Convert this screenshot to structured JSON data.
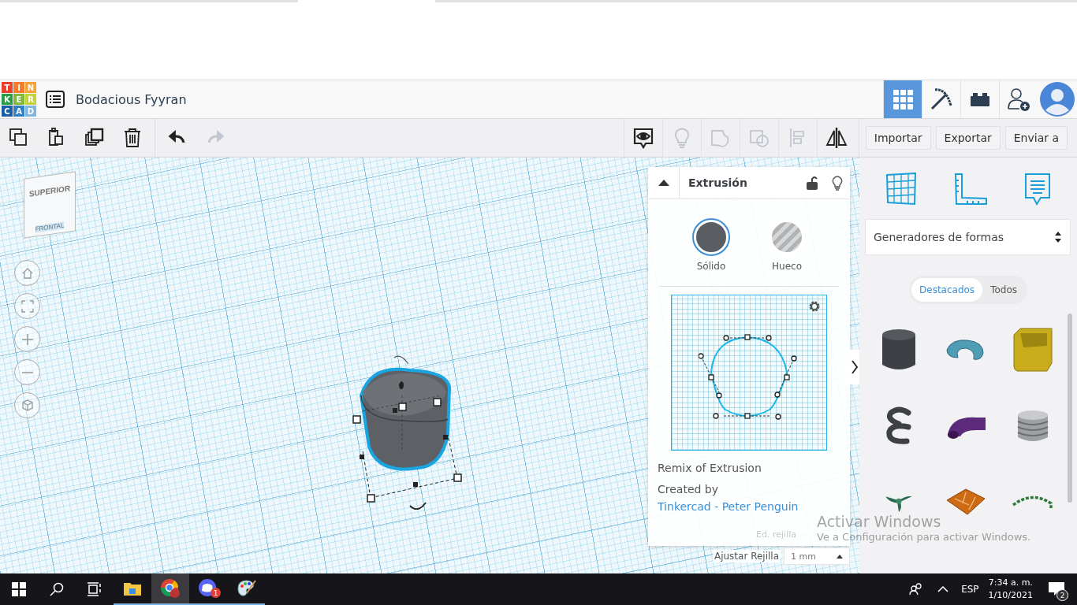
{
  "header": {
    "logo_letters": [
      "T",
      "I",
      "N",
      "K",
      "E",
      "R",
      "C",
      "A",
      "D"
    ],
    "title": "Bodacious Fyyran",
    "view_buttons": [
      {
        "kind": "grid",
        "selected": true
      },
      {
        "kind": "pickaxe",
        "selected": false
      },
      {
        "kind": "brick",
        "selected": false
      }
    ]
  },
  "toolbar": {
    "tools": [
      {
        "kind": "copy",
        "disabled": false
      },
      {
        "kind": "paste",
        "disabled": false
      },
      {
        "kind": "duplicate",
        "disabled": false
      },
      {
        "kind": "delete",
        "disabled": false
      },
      {
        "kind": "undo",
        "disabled": false
      },
      {
        "kind": "redo",
        "disabled": true
      }
    ],
    "right_tools": [
      {
        "kind": "eye",
        "disabled": false
      },
      {
        "kind": "bulb",
        "disabled": true
      },
      {
        "kind": "group",
        "disabled": true
      },
      {
        "kind": "ungroup",
        "disabled": true
      },
      {
        "kind": "align",
        "disabled": true
      },
      {
        "kind": "mirror",
        "disabled": false
      }
    ],
    "buttons": [
      "Importar",
      "Exportar",
      "Enviar a"
    ]
  },
  "view_cube": {
    "top": "SUPERIOR",
    "front": "FRONTAL"
  },
  "inspector": {
    "title": "Extrusión",
    "locked": false,
    "modes": [
      {
        "label": "Sólido",
        "kind": "solid",
        "selected": true
      },
      {
        "label": "Hueco",
        "kind": "hole",
        "selected": false
      }
    ],
    "remix": "Remix of Extrusion",
    "credit_prefix": "Created by",
    "credit_link": "Tinkercad - Peter Penguin"
  },
  "grid_settings": {
    "edit_label": "Ed. rejilla",
    "snap_label": "Ajustar Rejilla",
    "snap_value": "1 mm"
  },
  "sidebar": {
    "category": "Generadores de formas",
    "filters": [
      {
        "label": "Destacados",
        "selected": true
      },
      {
        "label": "Todos",
        "selected": false
      }
    ],
    "shapes": [
      {
        "kind": "cylinder"
      },
      {
        "kind": "torus"
      },
      {
        "kind": "box"
      },
      {
        "kind": "spring"
      },
      {
        "kind": "pipe"
      },
      {
        "kind": "screw"
      },
      {
        "kind": "propeller"
      },
      {
        "kind": "tile"
      },
      {
        "kind": "arc"
      }
    ]
  },
  "watermark": {
    "title": "Activar Windows",
    "subtitle": "Ve a Configuración para activar Windows."
  },
  "taskbar": {
    "apps": [
      {
        "kind": "explorer",
        "active": false
      },
      {
        "kind": "chrome",
        "active": true
      },
      {
        "kind": "discord",
        "active": false,
        "badge": "1"
      },
      {
        "kind": "paint",
        "active": false
      }
    ],
    "language": "ESP",
    "time": "7:34 a. m.",
    "date": "1/10/2021",
    "notifications": "2"
  }
}
